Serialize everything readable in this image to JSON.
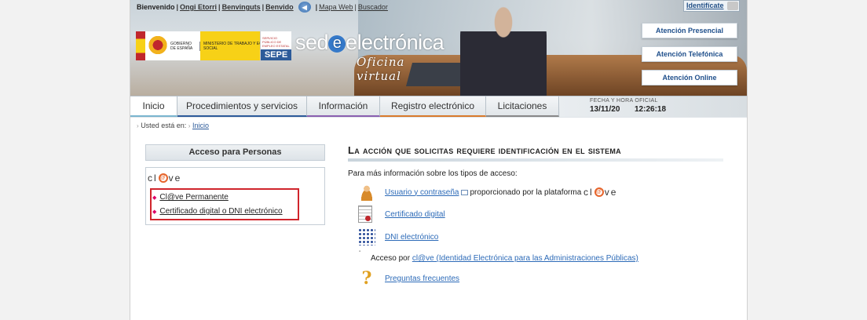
{
  "topbar": {
    "welcome": "Bienvenido",
    "lang_eu": "Ongi Etorri",
    "lang_ca": "Benvinguts",
    "lang_gl": "Benvido",
    "mapa": "Mapa Web",
    "buscador": "Buscador"
  },
  "identificate": "Identifícate",
  "logos": {
    "gobierno": "GOBIERNO DE ESPAÑA",
    "ministerio": "MINISTERIO DE TRABAJO Y ECONOMÍA SOCIAL",
    "sepe_small": "SERVICIO PÚBLICO DE EMPLEO ESTATAL",
    "sepe": "SEPE"
  },
  "brand": {
    "sede_pre": "sed",
    "sede_e": "e",
    "sede_post": "electrónica",
    "oficina": "Oficina virtual"
  },
  "side_buttons": [
    "Atención Presencial",
    "Atención Telefónica",
    "Atención Online"
  ],
  "nav": {
    "tabs": [
      "Inicio",
      "Procedimientos y servicios",
      "Información",
      "Registro electrónico",
      "Licitaciones"
    ],
    "date_label": "FECHA Y HORA OFICIAL",
    "date": "13/11/20",
    "time": "12:26:18"
  },
  "breadcrumb": {
    "prefix": "Usted está en:",
    "link": "Inicio"
  },
  "left": {
    "title": "Acceso para Personas",
    "clave_pre": "cl",
    "clave_o": "@",
    "clave_post": "ve",
    "options": [
      "Cl@ve Permanente",
      "Certificado digital o DNI electrónico"
    ]
  },
  "main": {
    "title": "La acción que solicitas requiere identificación en el sistema",
    "info": "Para más información sobre los tipos de acceso:",
    "usuario_link": "Usuario y contraseña",
    "usuario_suffix": "proporcionado por la plataforma",
    "cert_link": "Certificado digital",
    "dni_link": "DNI electrónico",
    "acceso_prefix": "Acceso por",
    "acceso_link": "cl@ve (Identidad Electrónica para las Administraciones Públicas)",
    "faq_link": "Preguntas frecuentes"
  }
}
